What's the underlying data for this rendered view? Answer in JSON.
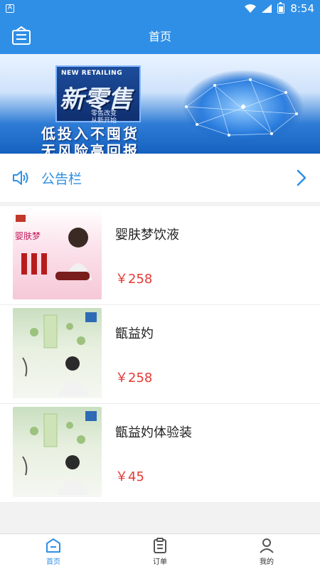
{
  "status_bar": {
    "notification_glyph": "A",
    "time": "8:54"
  },
  "header": {
    "title": "首页",
    "menu_icon": "box-menu-icon"
  },
  "banner": {
    "sign_en": "NEW RETAILING",
    "sign_big": "新零售",
    "sign_small1": "零售改变",
    "sign_small2": "从新开始",
    "line1": "低投入不囤货",
    "line2": "无风险高回报"
  },
  "notice": {
    "label": "公告栏"
  },
  "products": [
    {
      "name": "婴肤梦饮液",
      "price": "￥258",
      "thumb": "pink"
    },
    {
      "name": "甑益妁",
      "price": "￥258",
      "thumb": "green"
    },
    {
      "name": "甑益妁体验装",
      "price": "￥45",
      "thumb": "green"
    }
  ],
  "nav": [
    {
      "label": "首页",
      "icon": "home-icon",
      "active": true
    },
    {
      "label": "订单",
      "icon": "clipboard-icon",
      "active": false
    },
    {
      "label": "我的",
      "icon": "user-icon",
      "active": false
    }
  ],
  "colors": {
    "primary": "#2f8fe6",
    "price": "#e53935"
  }
}
